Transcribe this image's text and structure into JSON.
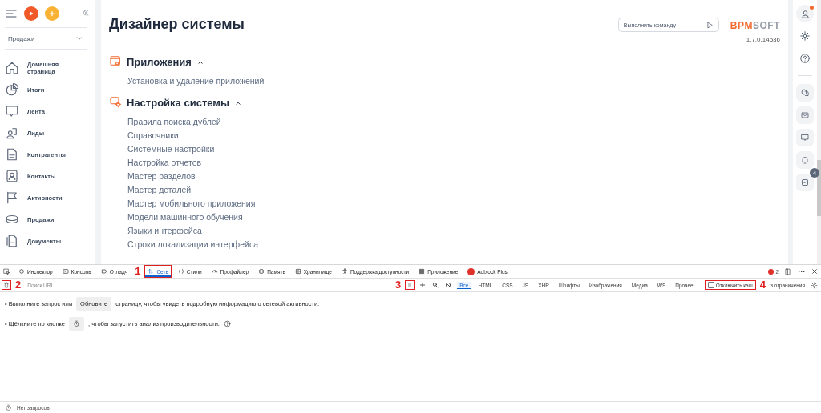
{
  "sidebar": {
    "section_select": "Продажи",
    "items": [
      {
        "label": "Домашняя страница"
      },
      {
        "label": "Итоги"
      },
      {
        "label": "Лента"
      },
      {
        "label": "Лиды"
      },
      {
        "label": "Контрагенты"
      },
      {
        "label": "Контакты"
      },
      {
        "label": "Активности"
      },
      {
        "label": "Продажи"
      },
      {
        "label": "Документы"
      }
    ]
  },
  "page": {
    "title": "Дизайнер системы",
    "command": {
      "placeholder": "Выполнить команду"
    },
    "logo": {
      "accent": "BPM",
      "rest": "SOFT"
    },
    "version": "1.7.0.14536",
    "groups": [
      {
        "title": "Приложения",
        "expanded": true,
        "items": [
          "Установка и удаление приложений"
        ]
      },
      {
        "title": "Настройка системы",
        "expanded": true,
        "items": [
          "Правила поиска дублей",
          "Справочники",
          "Системные настройки",
          "Настройка отчетов",
          "Мастер разделов",
          "Мастер деталей",
          "Мастер мобильного приложения",
          "Модели машинного обучения",
          "Языки интерфейса",
          "Строки локализации интерфейса"
        ]
      }
    ]
  },
  "right_rail": {
    "notification_dot": true,
    "tasks_badge": "4"
  },
  "devtools": {
    "tabs": [
      {
        "label": "Инспектор",
        "selected": false
      },
      {
        "label": "Консоль",
        "selected": false
      },
      {
        "label": "Отладч",
        "selected": false
      },
      {
        "label": "Сеть",
        "selected": true,
        "marker": "1"
      },
      {
        "label": "Стили",
        "selected": false
      },
      {
        "label": "Профайлер",
        "selected": false
      },
      {
        "label": "Память",
        "selected": false
      },
      {
        "label": "Хранилище",
        "selected": false
      },
      {
        "label": "Поддержка доступности",
        "selected": false
      },
      {
        "label": "Приложение",
        "selected": false
      },
      {
        "label": "Adblock Plus",
        "selected": false
      }
    ],
    "error_count": "2",
    "clear_marker": "2",
    "filter": {
      "placeholder": "Поиск URL"
    },
    "pause_marker": "3",
    "types": [
      {
        "label": "Все",
        "selected": true
      },
      {
        "label": "HTML",
        "selected": false
      },
      {
        "label": "CSS",
        "selected": false
      },
      {
        "label": "JS",
        "selected": false
      },
      {
        "label": "XHR",
        "selected": false
      },
      {
        "label": "Шрифты",
        "selected": false
      },
      {
        "label": "Изображения",
        "selected": false
      },
      {
        "label": "Медиа",
        "selected": false
      },
      {
        "label": "WS",
        "selected": false
      },
      {
        "label": "Прочее",
        "selected": false
      }
    ],
    "disable_cache": {
      "label": "Отключить кэш",
      "checked": false,
      "marker": "4"
    },
    "throttling": "з ограничения",
    "hint_1": {
      "before": "• Выполните запрос или",
      "button": "Обновите",
      "after": "страницу, чтобы увидеть подробную информацию о сетевой активности."
    },
    "hint_2": {
      "before": "• Щёлкните по кнопке",
      "after": ", чтобы запустить анализ производительности."
    },
    "status": "Нет запросов"
  }
}
